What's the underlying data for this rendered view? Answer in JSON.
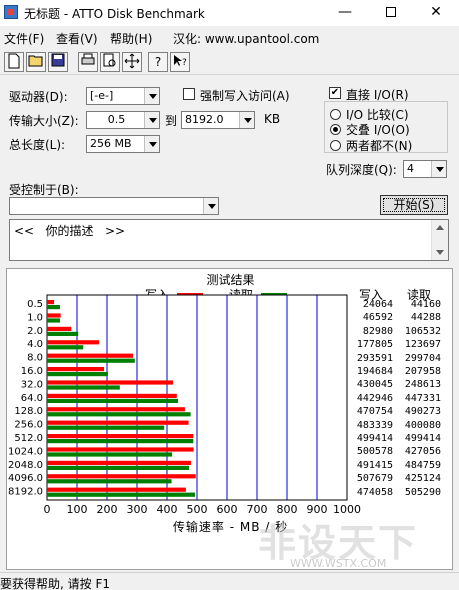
{
  "window": {
    "title": "无标题 - ATTO Disk Benchmark",
    "min": "—",
    "close": "✕"
  },
  "menu": {
    "file": "文件(F)",
    "view": "查看(V)",
    "help": "帮助(H)",
    "localized": "汉化: www.upantool.com"
  },
  "toolbar_icons": [
    "new-icon",
    "open-icon",
    "save-icon",
    "print-icon",
    "print-preview-icon",
    "move-icon",
    "help-icon",
    "context-help-icon"
  ],
  "settings": {
    "drive_label": "驱动器(D):",
    "drive_value": "[-e-]",
    "force_write_label": "强制写入访问(A)",
    "direct_io_label": "直接 I/O(R)",
    "direct_io_checked": true,
    "transfer_label": "传输大小(Z):",
    "transfer_from": "0.5",
    "to_label": "到",
    "transfer_to": "8192.0",
    "kb_label": "KB",
    "total_label": "总长度(L):",
    "total_value": "256 MB",
    "io_compare": "I/O 比较(C)",
    "overlapped_io": "交叠 I/O(O)",
    "neither": "两者都不(N)",
    "queue_depth_label": "队列深度(Q):",
    "queue_depth_value": "4",
    "controlled_by_label": "受控制于(B):",
    "controlled_by_value": "",
    "start_button": "开始(S)",
    "description": "<<   你的描述   >>"
  },
  "results": {
    "title": "测试结果",
    "write_label": "写入",
    "read_label": "读取",
    "col_write": "写入",
    "col_read": "读取",
    "x_axis_title": "传输速率 - MB / 秒",
    "write_color": "#ff0000",
    "read_color": "#008000"
  },
  "chart_data": {
    "type": "bar",
    "orientation": "horizontal",
    "title": "测试结果",
    "xlabel": "传输速率 - MB / 秒",
    "xlim": [
      0,
      1000
    ],
    "x_ticks": [
      "0",
      "100",
      "200",
      "300",
      "400",
      "500",
      "600",
      "700",
      "800",
      "900",
      "1000"
    ],
    "categories": [
      "0.5",
      "1.0",
      "2.0",
      "4.0",
      "8.0",
      "16.0",
      "32.0",
      "64.0",
      "128.0",
      "256.0",
      "512.0",
      "1024.0",
      "2048.0",
      "4096.0",
      "8192.0"
    ],
    "series": [
      {
        "name": "写入",
        "values": [
          24064,
          46592,
          82980,
          177805,
          293591,
          194684,
          430045,
          442946,
          470754,
          483339,
          499414,
          500578,
          491415,
          507679,
          474058
        ]
      },
      {
        "name": "读取",
        "values": [
          44160,
          44288,
          106532,
          123697,
          299704,
          207958,
          248613,
          447331,
          490273,
          400080,
          499414,
          427056,
          484759,
          425124,
          505290
        ]
      }
    ]
  },
  "status": {
    "text": "要获得帮助, 请按 F1"
  },
  "watermark": {
    "text": "非设天下",
    "url": "WWW.WSTX.COM"
  }
}
